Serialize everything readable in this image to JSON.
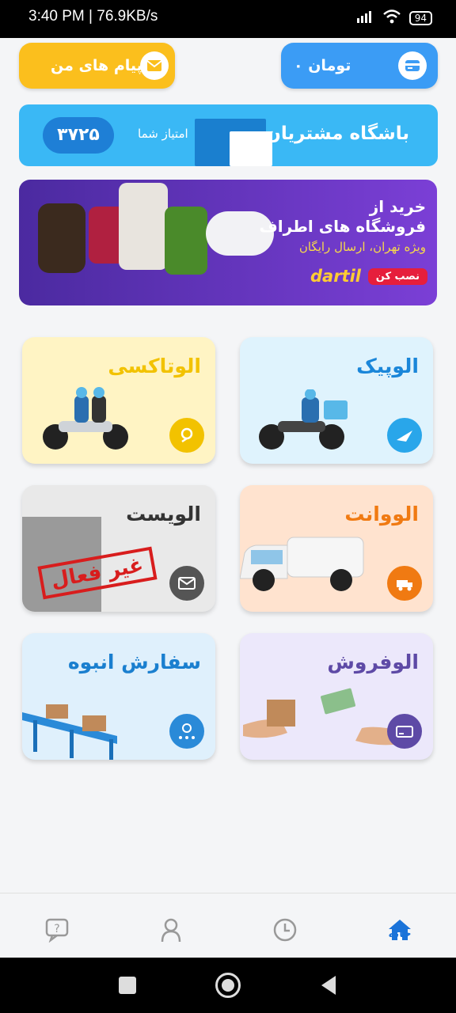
{
  "status_bar": {
    "time": "3:40 PM | 76.9KB/s",
    "battery": "94"
  },
  "wallet": {
    "label": "۰ تومان"
  },
  "messages": {
    "label": "پیام های من"
  },
  "club": {
    "title": "باشگاه مشتریان",
    "score_label": "امتیاز شما",
    "score": "۳۷۲۵"
  },
  "promo": {
    "line1": "خرید از",
    "line2": "فروشگاه های اطراف",
    "line3": "ویژه تهران، ارسال رایگان",
    "install_label": "نصب کن",
    "brand": "dartil"
  },
  "services": [
    {
      "title": "الوپیک",
      "color": "#1a86d9",
      "status": "active"
    },
    {
      "title": "الوتاکسی",
      "color": "#f2c200",
      "status": "active"
    },
    {
      "title": "الووانت",
      "color": "#f07a12",
      "status": "active"
    },
    {
      "title": "الویست",
      "color": "#333333",
      "status": "غیر فعال"
    },
    {
      "title": "الوفروش",
      "color": "#5e4aa6",
      "status": "active"
    },
    {
      "title": "سفارش انبوه",
      "color": "#1a7fcf",
      "status": "active"
    }
  ],
  "bottom_nav": {
    "home_label": "خانه",
    "active": "home"
  },
  "colors": {
    "accent_blue": "#3b9cf5",
    "accent_yellow": "#fbbf1d",
    "club_bg": "#3ab8f5"
  }
}
